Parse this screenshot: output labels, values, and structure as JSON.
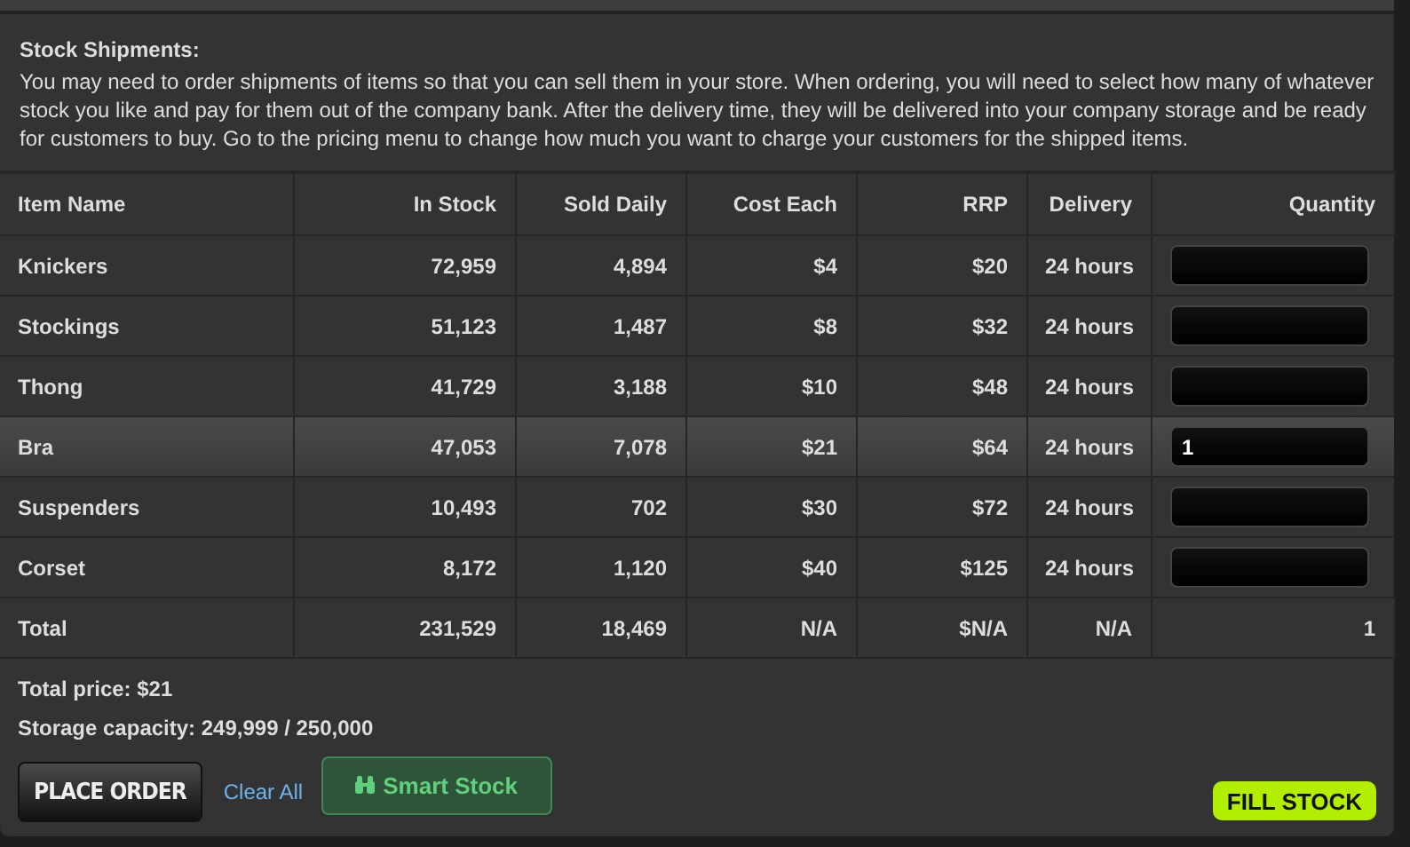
{
  "title": "Stock Shipments:",
  "intro": "You may need to order shipments of items so that you can sell them in your store. When ordering, you will need to select how many of whatever stock you like and pay for them out of the company bank. After the delivery time, they will be delivered into your company storage and be ready for customers to buy. Go to the pricing menu to change how much you want to charge your customers for the shipped items.",
  "table": {
    "columns": [
      "Item Name",
      "In Stock",
      "Sold Daily",
      "Cost Each",
      "RRP",
      "Delivery",
      "Quantity"
    ],
    "rows": [
      {
        "name": "Knickers",
        "in_stock": "72,959",
        "sold_daily": "4,894",
        "cost": "$4",
        "rrp": "$20",
        "delivery": "24 hours",
        "quantity": "",
        "selected": false
      },
      {
        "name": "Stockings",
        "in_stock": "51,123",
        "sold_daily": "1,487",
        "cost": "$8",
        "rrp": "$32",
        "delivery": "24 hours",
        "quantity": "",
        "selected": false
      },
      {
        "name": "Thong",
        "in_stock": "41,729",
        "sold_daily": "3,188",
        "cost": "$10",
        "rrp": "$48",
        "delivery": "24 hours",
        "quantity": "",
        "selected": false
      },
      {
        "name": "Bra",
        "in_stock": "47,053",
        "sold_daily": "7,078",
        "cost": "$21",
        "rrp": "$64",
        "delivery": "24 hours",
        "quantity": "1",
        "selected": true
      },
      {
        "name": "Suspenders",
        "in_stock": "10,493",
        "sold_daily": "702",
        "cost": "$30",
        "rrp": "$72",
        "delivery": "24 hours",
        "quantity": "",
        "selected": false
      },
      {
        "name": "Corset",
        "in_stock": "8,172",
        "sold_daily": "1,120",
        "cost": "$40",
        "rrp": "$125",
        "delivery": "24 hours",
        "quantity": "",
        "selected": false
      }
    ],
    "total": [
      "Total",
      "231,529",
      "18,469",
      "N/A",
      "$N/A",
      "N/A",
      "1"
    ]
  },
  "total_price": "Total price: $21",
  "storage": "Storage capacity: 249,999 / 250,000",
  "buttons": {
    "place_order": "PLACE ORDER",
    "clear_all": "Clear All",
    "smart_stock": "Smart Stock",
    "fill_stock": "FILL STOCK"
  }
}
